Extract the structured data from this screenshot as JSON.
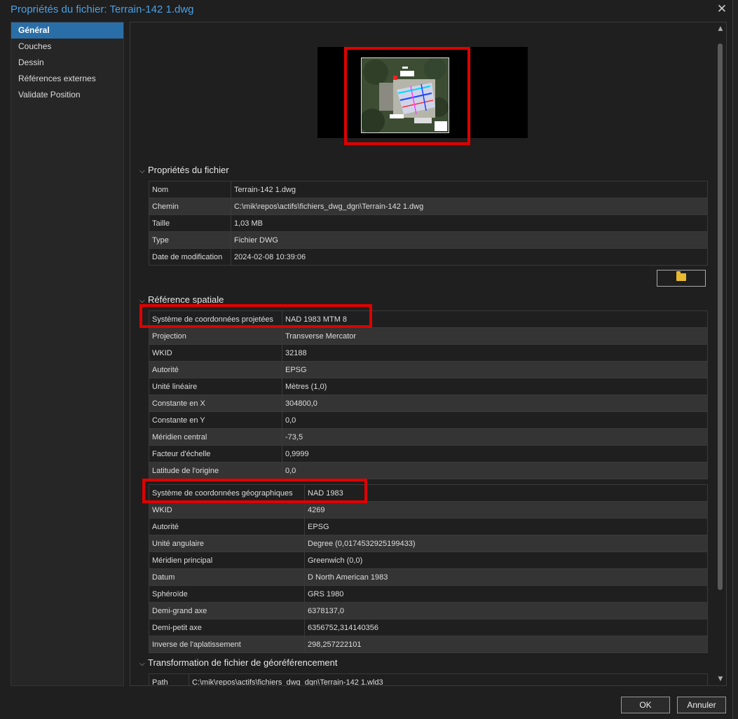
{
  "window": {
    "title": "Propriétés du fichier: Terrain-142 1.dwg",
    "close_glyph": "✕"
  },
  "sidebar": {
    "items": [
      {
        "label": "Général",
        "active": true
      },
      {
        "label": "Couches"
      },
      {
        "label": "Dessin"
      },
      {
        "label": "Références externes"
      },
      {
        "label": "Validate Position"
      }
    ]
  },
  "sections": {
    "file_props": "Propriétés du fichier",
    "spatial_ref": "Référence spatiale",
    "georef_transform": "Transformation de fichier de géoréférencement"
  },
  "file_properties": [
    {
      "key": "Nom",
      "value": "Terrain-142 1.dwg"
    },
    {
      "key": "Chemin",
      "value": "C:\\mik\\repos\\actifs\\fichiers_dwg_dgn\\Terrain-142 1.dwg"
    },
    {
      "key": "Taille",
      "value": "1,03 MB"
    },
    {
      "key": "Type",
      "value": "Fichier DWG"
    },
    {
      "key": "Date de modification",
      "value": "2024-02-08 10:39:06"
    }
  ],
  "projected_cs": [
    {
      "key": "Système de coordonnées projetées",
      "value": "NAD 1983 MTM  8"
    },
    {
      "key": "Projection",
      "value": "Transverse Mercator"
    },
    {
      "key": "WKID",
      "value": "32188"
    },
    {
      "key": "Autorité",
      "value": "EPSG"
    },
    {
      "key": "Unité linéaire",
      "value": "Mètres (1,0)"
    },
    {
      "key": "Constante en X",
      "value": "304800,0"
    },
    {
      "key": "Constante en Y",
      "value": "0,0"
    },
    {
      "key": "Méridien central",
      "value": "-73,5"
    },
    {
      "key": "Facteur d'échelle",
      "value": "0,9999"
    },
    {
      "key": "Latitude de l'origine",
      "value": "0,0"
    }
  ],
  "geographic_cs": [
    {
      "key": "Système de coordonnées géographiques",
      "value": "NAD 1983"
    },
    {
      "key": "WKID",
      "value": "4269"
    },
    {
      "key": "Autorité",
      "value": "EPSG"
    },
    {
      "key": "Unité angulaire",
      "value": "Degree (0,0174532925199433)"
    },
    {
      "key": "Méridien principal",
      "value": "Greenwich (0,0)"
    },
    {
      "key": "Datum",
      "value": "D North American 1983"
    },
    {
      "key": "Sphéroïde",
      "value": "GRS 1980"
    },
    {
      "key": "Demi-grand axe",
      "value": "6378137,0"
    },
    {
      "key": "Demi-petit axe",
      "value": "6356752,314140356"
    },
    {
      "key": "Inverse de l'aplatissement",
      "value": "298,257222101"
    }
  ],
  "georef": [
    {
      "key": "Path",
      "value": "C:\\mik\\repos\\actifs\\fichiers_dwg_dgn\\Terrain-142 1.wld3"
    }
  ],
  "buttons": {
    "ok": "OK",
    "cancel": "Annuler"
  },
  "icons": {
    "browse": "folder-open-icon",
    "collapse": "chevron-down-icon"
  },
  "colors": {
    "accent": "#2a6ea8",
    "title": "#4aa0e6",
    "highlight": "#e00000"
  }
}
